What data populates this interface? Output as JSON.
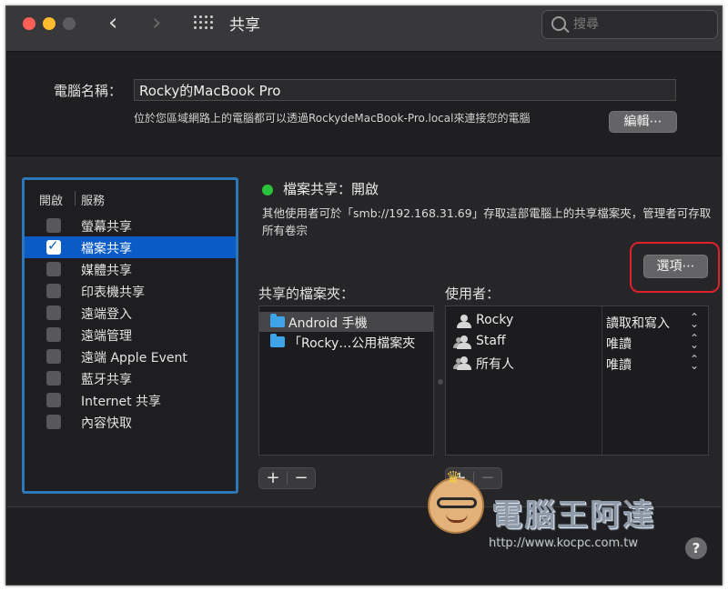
{
  "window": {
    "title": "共享",
    "nav_back": "‹",
    "nav_forward": "›",
    "search_placeholder": "搜尋"
  },
  "computer_name": {
    "label": "電腦名稱：",
    "value": "Rocky的MacBook Pro",
    "description": "位於您區域網路上的電腦都可以透過RockydeMacBook-Pro.local來連接您的電腦",
    "edit_button": "編輯⋯"
  },
  "services": {
    "header_on": "開啟",
    "header_service": "服務",
    "items": [
      {
        "label": "螢幕共享",
        "checked": false,
        "selected": false
      },
      {
        "label": "檔案共享",
        "checked": true,
        "selected": true
      },
      {
        "label": "媒體共享",
        "checked": false,
        "selected": false
      },
      {
        "label": "印表機共享",
        "checked": false,
        "selected": false
      },
      {
        "label": "遠端登入",
        "checked": false,
        "selected": false
      },
      {
        "label": "遠端管理",
        "checked": false,
        "selected": false
      },
      {
        "label": "遠端 Apple Event",
        "checked": false,
        "selected": false
      },
      {
        "label": "藍牙共享",
        "checked": false,
        "selected": false
      },
      {
        "label": "Internet 共享",
        "checked": false,
        "selected": false
      },
      {
        "label": "內容快取",
        "checked": false,
        "selected": false
      }
    ]
  },
  "status": {
    "title": "檔案共享：開啟",
    "description": "其他使用者可於「smb://192.168.31.69」存取這部電腦上的共享檔案夾，管理者可存取所有卷宗",
    "color": "#2cc23c"
  },
  "options_button": "選項⋯",
  "shared_folders": {
    "label": "共享的檔案夾：",
    "items": [
      {
        "label": "Android 手機"
      },
      {
        "label": "「Rocky…公用檔案夾"
      }
    ]
  },
  "users": {
    "label": "使用者：",
    "items": [
      {
        "name": "Rocky",
        "permission": "讀取和寫入",
        "icon": "user-icon"
      },
      {
        "name": "Staff",
        "permission": "唯讀",
        "icon": "group-icon"
      },
      {
        "name": "所有人",
        "permission": "唯讀",
        "icon": "everyone-icon"
      }
    ]
  },
  "controls": {
    "plus": "+",
    "minus": "−",
    "stepper": "⌃⌄"
  },
  "watermark": {
    "title": "電腦王阿達",
    "url": "http://www.kocpc.com.tw"
  },
  "help": "?"
}
